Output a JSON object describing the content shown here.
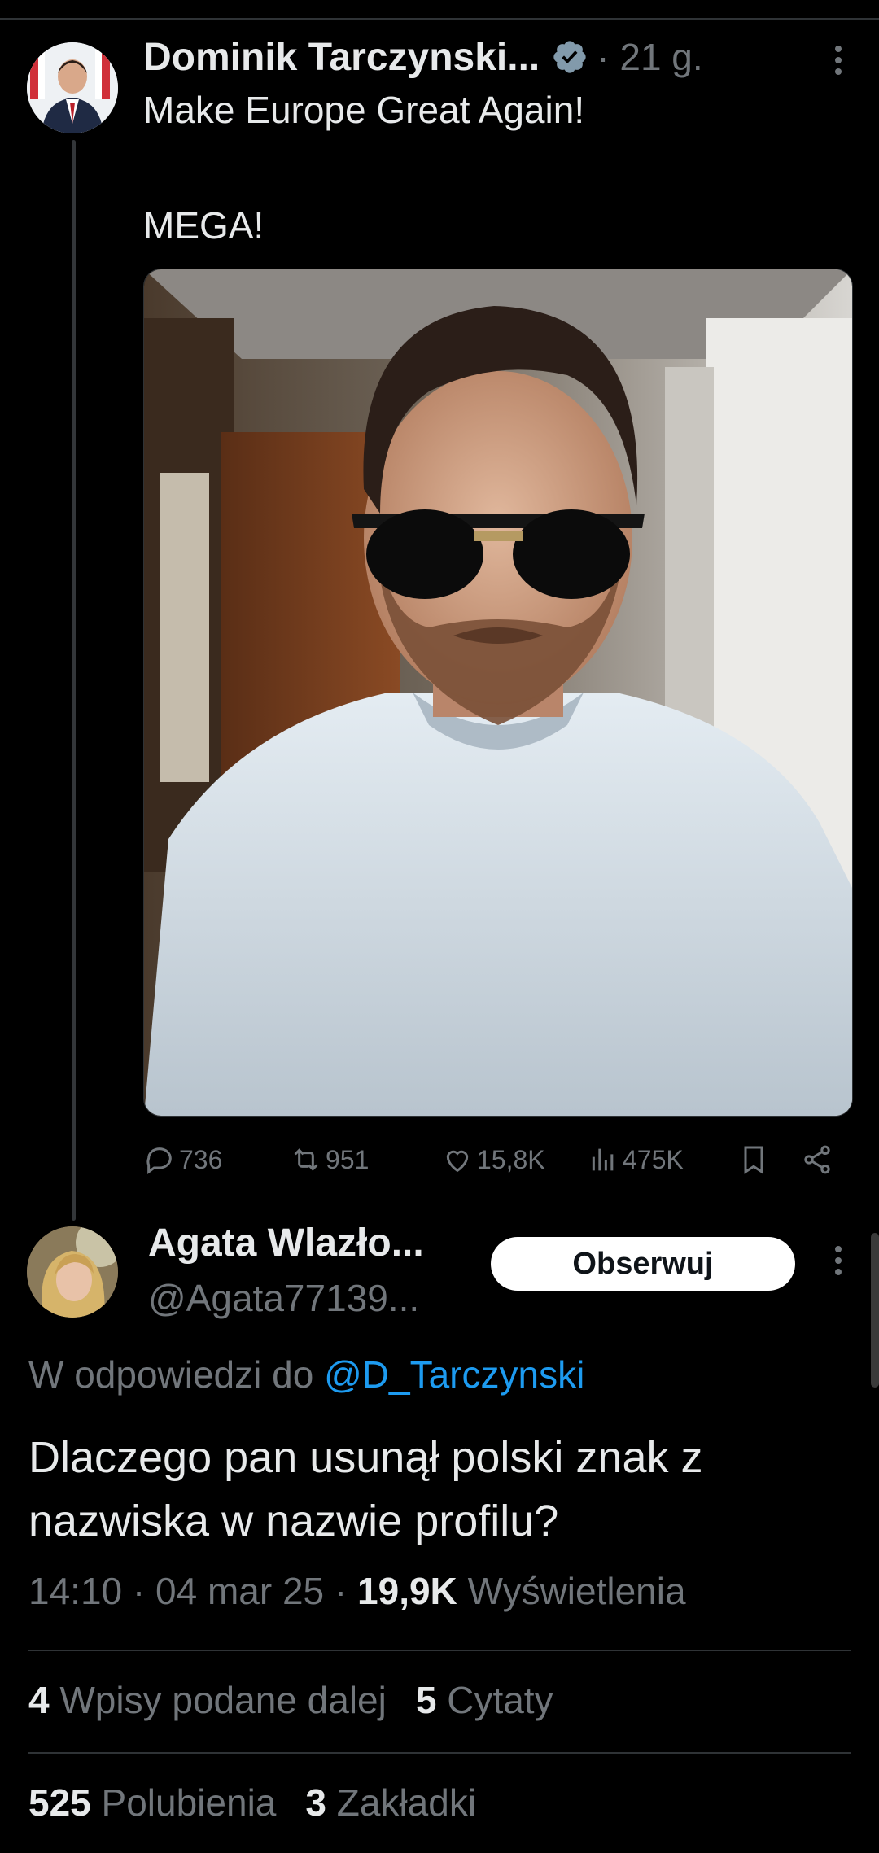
{
  "parent_tweet": {
    "author_name": "Dominik Tarczynski...",
    "time": "· 21 g.",
    "text_line1": "Make Europe Great Again!",
    "text_line2": "MEGA!",
    "actions": {
      "replies": "736",
      "reposts": "951",
      "likes": "15,8K",
      "views": "475K"
    }
  },
  "reply": {
    "author_name": "Agata Wlazło...",
    "handle": "@Agata77139...",
    "follow_label": "Obserwuj",
    "replying_prefix": "W odpowiedzi do",
    "replying_to": "@D_Tarczynski",
    "text_line1": "Dlaczego pan usunął polski znak z",
    "text_line2": "nazwiska w nazwie profilu?",
    "time": "14:10",
    "date": "04 mar 25",
    "views_count": "19,9K",
    "views_label": "Wyświetlenia",
    "reposts_count": "4",
    "reposts_label": "Wpisy podane dalej",
    "quotes_count": "5",
    "quotes_label": "Cytaty",
    "likes_count": "525",
    "likes_label": "Polubienia",
    "bookmarks_count": "3",
    "bookmarks_label": "Zakładki"
  },
  "colors": {
    "background": "#000000",
    "text": "#e7e9ea",
    "muted": "#71767b",
    "link": "#1d9bf0",
    "verified": "#829aab"
  },
  "icons": [
    "reply-icon",
    "repost-icon",
    "like-icon",
    "views-icon",
    "bookmark-icon",
    "share-icon",
    "verified-icon",
    "more-icon"
  ]
}
